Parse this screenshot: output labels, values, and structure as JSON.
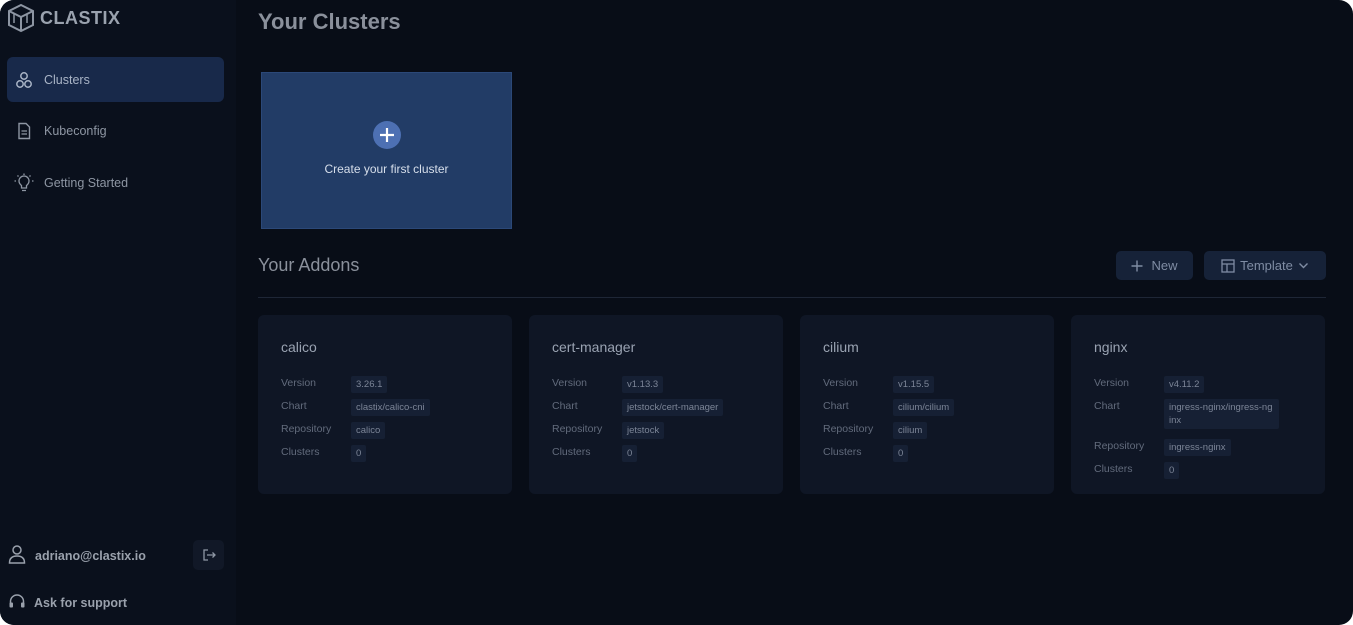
{
  "app": {
    "brand": "CLASTIX"
  },
  "sidebar": {
    "items": [
      {
        "label": "Clusters",
        "icon": "clusters-icon",
        "active": true
      },
      {
        "label": "Kubeconfig",
        "icon": "document-icon",
        "active": false
      },
      {
        "label": "Getting Started",
        "icon": "lightbulb-icon",
        "active": false
      }
    ],
    "user_email": "adriano@clastix.io",
    "support_label": "Ask for support"
  },
  "main": {
    "clusters_title": "Your Clusters",
    "create_cluster_label": "Create your first cluster",
    "addons_title": "Your Addons",
    "new_button_label": "New",
    "template_button_label": "Template",
    "addons": [
      {
        "name": "calico",
        "version": "3.26.1",
        "chart": "clastix/calico-cni",
        "repository": "calico",
        "clusters": "0"
      },
      {
        "name": "cert-manager",
        "version": "v1.13.3",
        "chart": "jetstock/cert-manager",
        "repository": "jetstock",
        "clusters": "0"
      },
      {
        "name": "cilium",
        "version": "v1.15.5",
        "chart": "cilium/cilium",
        "repository": "cilium",
        "clusters": "0"
      },
      {
        "name": "nginx",
        "version": "v4.11.2",
        "chart": "ingress-nginx/ingress-nginx",
        "repository": "ingress-nginx",
        "clusters": "0"
      }
    ],
    "addon_field_labels": {
      "version": "Version",
      "chart": "Chart",
      "repository": "Repository",
      "clusters": "Clusters"
    }
  },
  "colors": {
    "background": "#080d17",
    "sidebar": "#0a101c",
    "accent": "#223c66",
    "active_nav": "#18294a"
  }
}
